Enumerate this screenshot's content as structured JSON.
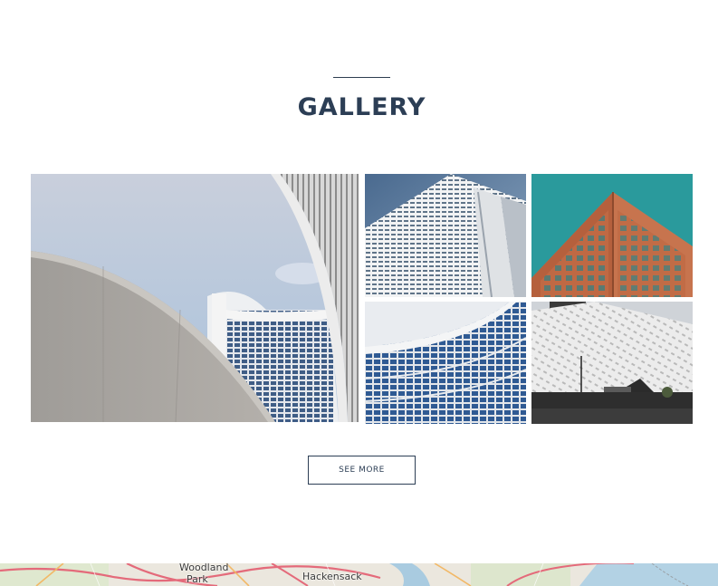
{
  "gallery": {
    "title": "GALLERY",
    "button_label": "SEE MORE",
    "photos": [
      {
        "name": "curved-tower-concrete-wall"
      },
      {
        "name": "white-skyscraper"
      },
      {
        "name": "orange-building-teal-sky"
      },
      {
        "name": "curved-blue-glass-facade"
      },
      {
        "name": "white-lattice-museum"
      }
    ]
  },
  "map": {
    "labels": [
      "Woodland",
      "Park",
      "Hackensack"
    ]
  },
  "colors": {
    "heading": "#2c3e55",
    "background": "#ffffff"
  }
}
